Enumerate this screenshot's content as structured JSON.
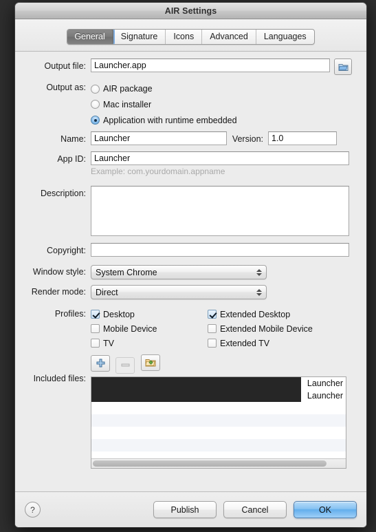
{
  "window": {
    "title": "AIR Settings"
  },
  "tabs": [
    {
      "label": "General",
      "selected": true
    },
    {
      "label": "Signature",
      "selected": false
    },
    {
      "label": "Icons",
      "selected": false
    },
    {
      "label": "Advanced",
      "selected": false
    },
    {
      "label": "Languages",
      "selected": false
    }
  ],
  "form": {
    "output_file": {
      "label": "Output file:",
      "value": "Launcher.app",
      "browse_icon": "folder-blue-icon"
    },
    "output_as": {
      "label": "Output as:",
      "options": [
        {
          "label": "AIR package",
          "selected": false
        },
        {
          "label": "Mac installer",
          "selected": false
        },
        {
          "label": "Application with runtime embedded",
          "selected": true
        }
      ]
    },
    "name": {
      "label": "Name:",
      "value": "Launcher"
    },
    "version": {
      "label": "Version:",
      "value": "1.0"
    },
    "app_id": {
      "label": "App ID:",
      "value": "Launcher",
      "hint": "Example: com.yourdomain.appname"
    },
    "description": {
      "label": "Description:",
      "value": ""
    },
    "copyright": {
      "label": "Copyright:",
      "value": ""
    },
    "window_style": {
      "label": "Window style:",
      "value": "System Chrome"
    },
    "render_mode": {
      "label": "Render mode:",
      "value": "Direct"
    },
    "profiles": {
      "label": "Profiles:",
      "left_column": [
        {
          "label": "Desktop",
          "checked": true
        },
        {
          "label": "Mobile Device",
          "checked": false
        },
        {
          "label": "TV",
          "checked": false
        }
      ],
      "right_column": [
        {
          "label": "Extended Desktop",
          "checked": true
        },
        {
          "label": "Extended Mobile Device",
          "checked": false
        },
        {
          "label": "Extended TV",
          "checked": false
        }
      ]
    },
    "included_files": {
      "label": "Included files:",
      "toolbar": [
        {
          "name": "add-file-button",
          "icon": "plus-icon",
          "enabled": true
        },
        {
          "name": "remove-file-button",
          "icon": "minus-icon",
          "enabled": false
        },
        {
          "name": "add-folder-button",
          "icon": "folder-add-icon",
          "enabled": true
        }
      ],
      "rows": [
        {
          "text": "Launcher",
          "redacted": true
        },
        {
          "text": "Launcher",
          "redacted": true
        },
        {
          "text": ""
        },
        {
          "text": ""
        },
        {
          "text": ""
        },
        {
          "text": ""
        },
        {
          "text": ""
        }
      ]
    }
  },
  "footer": {
    "help_label": "?",
    "publish_label": "Publish",
    "cancel_label": "Cancel",
    "ok_label": "OK"
  },
  "colors": {
    "accent_blue": "#63aeec",
    "selected_tab": "#7a7a7a",
    "window_bg": "#ececec"
  }
}
